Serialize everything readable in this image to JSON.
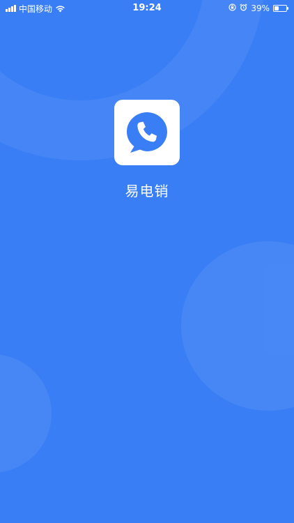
{
  "status_bar": {
    "carrier": "中国移动",
    "time": "19:24",
    "battery_percent_label": "39%",
    "battery_level": 0.39,
    "icons": [
      "signal-icon",
      "wifi-icon",
      "orientation-lock-icon",
      "alarm-icon",
      "battery-icon"
    ]
  },
  "splash": {
    "app_name": "易电销",
    "icon": "phone-chat-bubble-icon"
  },
  "colors": {
    "background": "#3a7ef5",
    "icon_background": "#ffffff",
    "icon_accent": "#3a7ef5"
  }
}
